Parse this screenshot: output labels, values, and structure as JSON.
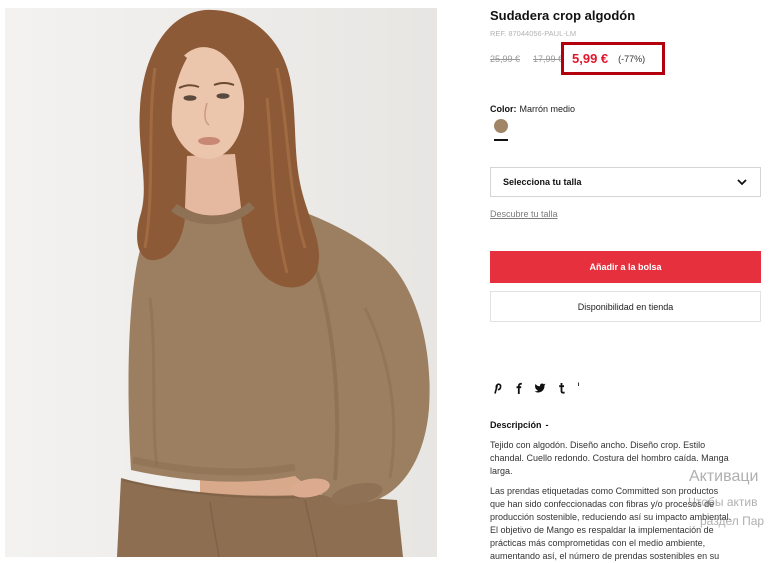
{
  "product": {
    "title": "Sudadera crop algodón",
    "ref": "REF. 87044056-PAUL-LM",
    "original_price": "25,99 €",
    "previous_price": "17,99 €",
    "current_price": "5,99 €",
    "discount": "(-77%)"
  },
  "color": {
    "label": "Color:",
    "value": "Marrón medio",
    "swatch": "#a28566"
  },
  "size": {
    "placeholder": "Selecciona tu talla",
    "icon": "chevron-down-icon",
    "guide_link": "Descubre tu talla"
  },
  "actions": {
    "add_to_bag": "Añadir a la bolsa",
    "store_availability": "Disponibilidad en tienda"
  },
  "share": {
    "icons": [
      "pinterest-icon",
      "facebook-icon",
      "twitter-icon",
      "tumblr-icon",
      "share-more-icon"
    ]
  },
  "description": {
    "heading": "Descripción",
    "toggle": "-",
    "paragraphs": [
      {
        "lines": [
          "Tejido con algodón. Diseño ancho. Diseño crop. Estilo",
          "chandal. Cuello redondo. Costura del hombro caída. Manga",
          "larga."
        ]
      },
      {
        "lines": [
          "Las prendas etiquetadas como Committed son productos",
          "que han sido confeccionadas con fibras y/o procesos de",
          "producción sostenible, reduciendo así su impacto ambiental.",
          "El objetivo de Mango es respaldar la implementación de",
          "prácticas más comprometidas con el medio ambiente,",
          "aumentando así, el número de prendas sostenibles en su"
        ]
      }
    ]
  },
  "watermark": {
    "lines": [
      "Активаци",
      "Чтобы актив",
      "раздел Пар"
    ]
  },
  "colors": {
    "add_to_bag_bg": "#e7303e",
    "price_red": "#e2162b",
    "highlight_border": "#b2000c",
    "garment_brown": "#9c7e60"
  }
}
